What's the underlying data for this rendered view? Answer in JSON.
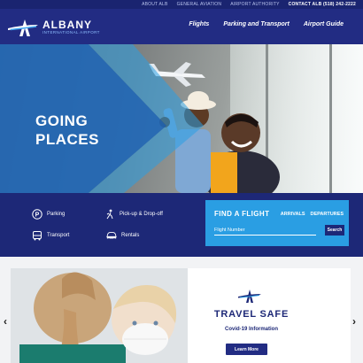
{
  "utility_nav": {
    "items": [
      "ABOUT ALB",
      "GENERAL AVIATION",
      "AIRPORT AUTHORITY"
    ],
    "contact": "CONTACT ALB (518) 242-2222"
  },
  "brand": {
    "name": "ALBANY",
    "sub": "INTERNATIONAL AIRPORT"
  },
  "main_nav": [
    "Flights",
    "Parking and Transport",
    "Airport Guide"
  ],
  "hero": {
    "line1": "GOING",
    "line2": "PLACES"
  },
  "quick_links": {
    "parking": "Parking",
    "pickup": "Pick-up & Drop-off",
    "transport": "Transport",
    "rentals": "Rentals"
  },
  "find_flight": {
    "title": "FIND A FLIGHT",
    "tab_arrivals": "ARRIVALS",
    "tab_departures": "DEPARTURES",
    "input_placeholder": "Flight Number",
    "search_label": "Search"
  },
  "promo": {
    "title": "TRAVEL SAFE",
    "subtitle": "Covid-19 Information",
    "button_label": "Learn More"
  },
  "colors": {
    "navy": "#222c83",
    "dark_navy": "#1d2877",
    "accent_blue": "#2a9ee3"
  }
}
